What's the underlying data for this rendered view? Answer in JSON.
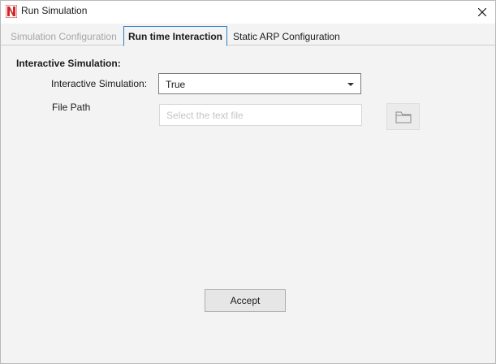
{
  "window": {
    "title": "Run Simulation",
    "close_glyph": "✕"
  },
  "tabs": [
    {
      "label": "Simulation Configuration",
      "state": "disabled"
    },
    {
      "label": "Run time Interaction",
      "state": "active"
    },
    {
      "label": "Static ARP Configuration",
      "state": "normal"
    }
  ],
  "form": {
    "section_heading": "Interactive Simulation:",
    "interactive_label": "Interactive Simulation:",
    "interactive_value": "True",
    "file_path_label": "File Path",
    "file_path_value": "",
    "file_path_placeholder": "Select the text file"
  },
  "actions": {
    "accept_label": "Accept"
  },
  "icons": {
    "app": "netsim-logo-icon",
    "close": "close-icon",
    "dropdown": "chevron-down-icon",
    "browse": "folder-icon"
  },
  "colors": {
    "active_tab_border": "#2d7fc4",
    "logo_red": "#d0262b"
  }
}
